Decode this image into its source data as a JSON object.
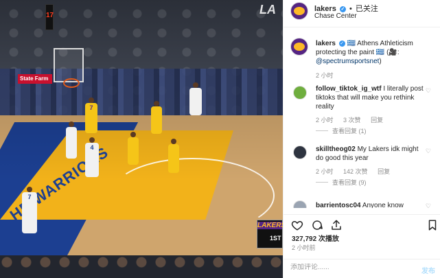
{
  "video": {
    "court_text": "HE WARRIORS",
    "shot_clock": "17",
    "sponsor": "State Farm",
    "scorebug_logo": "LAKERS",
    "scorebug_period": "1ST",
    "players": [
      {
        "number": "7",
        "team": "gold"
      },
      {
        "number": "4",
        "team": "white"
      },
      {
        "number": "7",
        "team": "white"
      }
    ]
  },
  "header": {
    "username": "lakers",
    "separator": "•",
    "follow": "已关注",
    "location": "Chase Center"
  },
  "caption": {
    "username": "lakers",
    "flag": "🇬🇷",
    "text": "Athens Athleticism protecting the paint",
    "emoji": "🇬🇷 (🎥:",
    "mention": "@spectrumsportsnet",
    "close": ")",
    "time": "2 小时"
  },
  "comments": [
    {
      "username": "follow_tiktok_ig_wtf",
      "text": "I literally post tiktoks that will make you rethink reality",
      "time": "2 小时",
      "likes": "3 次赞",
      "reply": "回复",
      "view_replies": "查看回复 (1)"
    },
    {
      "username": "skilltheog02",
      "text": "My Lakers idk might do good this year",
      "time": "2 小时",
      "likes": "142 次赞",
      "reply": "回复",
      "view_replies": "查看回复 (9)"
    },
    {
      "username": "barrientosc04",
      "text": "Anyone know"
    }
  ],
  "actions": {
    "likes": "327,792 次播放",
    "timestamp": "2 小时前"
  },
  "add_comment": {
    "placeholder": "添加评论......",
    "post": "发布"
  }
}
